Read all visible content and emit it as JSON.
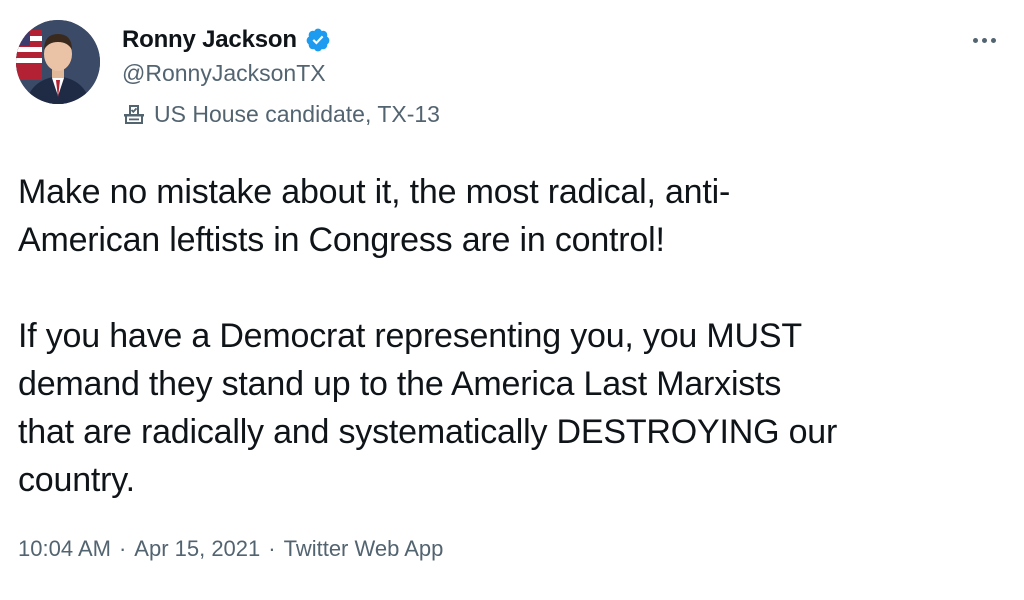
{
  "author": {
    "display_name": "Ronny Jackson",
    "handle": "@RonnyJacksonTX",
    "verified": true,
    "label_icon": "ballot-box-icon",
    "label": "US House candidate, TX-13",
    "avatar_icon": "profile-photo"
  },
  "more_icon": "more-horizontal-icon",
  "tweet": {
    "text": "Make no mistake about it, the most radical, anti-\nAmerican leftists in Congress are in control!\n\nIf you have a Democrat representing you, you MUST\ndemand they stand up to the America Last Marxists\nthat are radically and systematically DESTROYING our\ncountry.",
    "time": "10:04 AM",
    "date": "Apr 15, 2021",
    "source": "Twitter Web App",
    "separator": "·"
  },
  "colors": {
    "text": "#0f1419",
    "secondary": "#536471",
    "verified_blue": "#1d9bf0"
  }
}
